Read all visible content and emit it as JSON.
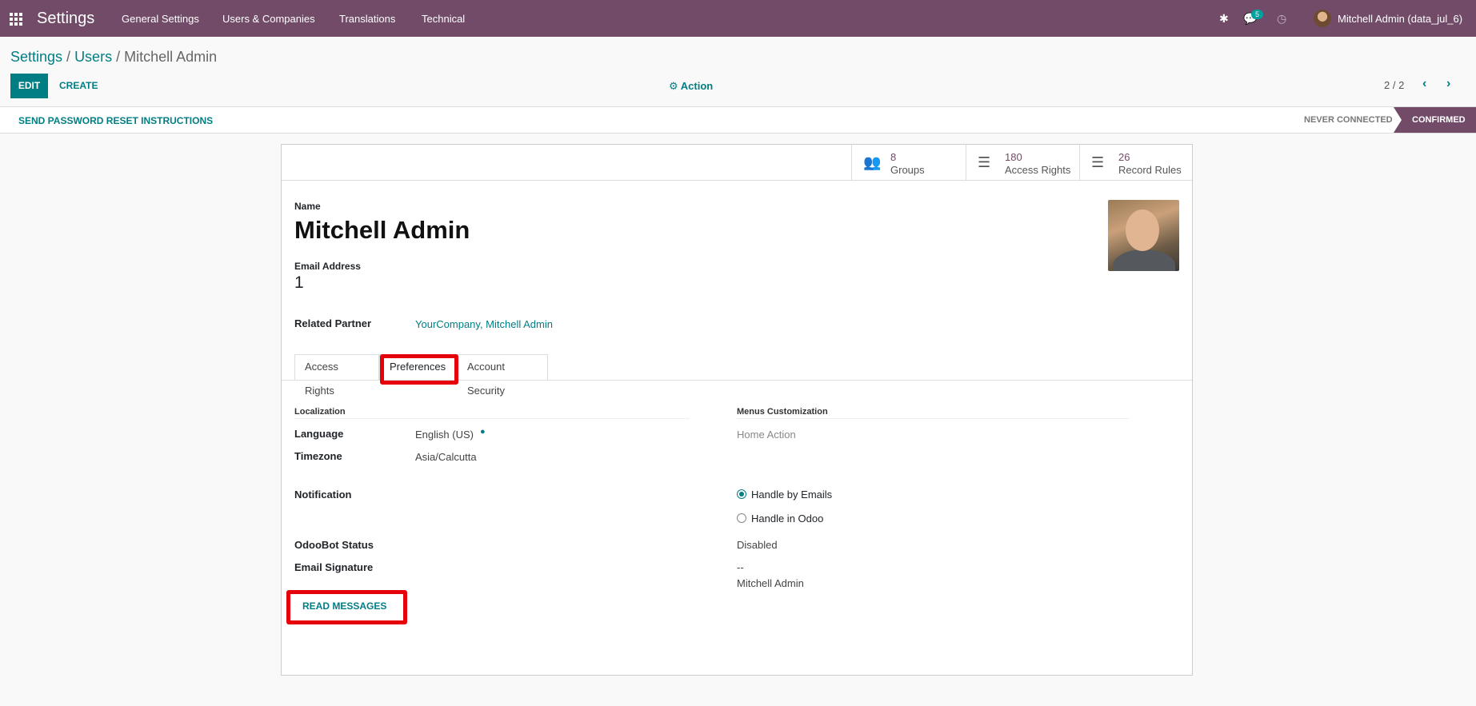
{
  "topbar": {
    "app_title": "Settings",
    "menu": [
      "General Settings",
      "Users & Companies",
      "Translations",
      "Technical"
    ],
    "icons": {
      "bug": "bug-icon",
      "chat": "chat-icon",
      "clock": "activity-clock-icon"
    },
    "chat_badge": "5",
    "user_name": "Mitchell Admin (data_jul_6)"
  },
  "breadcrumb": {
    "root": "Settings",
    "sep1": " / ",
    "mid": "Users",
    "sep2": " / ",
    "current": "Mitchell Admin"
  },
  "control": {
    "edit": "EDIT",
    "create": "CREATE",
    "action": "⚙ Action",
    "pager": "2 / 2",
    "prev": "‹",
    "next": "›"
  },
  "statusbar": {
    "reset_button": "SEND PASSWORD RESET INSTRUCTIONS",
    "stages": [
      "NEVER CONNECTED",
      "CONFIRMED"
    ],
    "active_stage": "CONFIRMED"
  },
  "smart_buttons": [
    {
      "value": "8",
      "label": "Groups",
      "icon": "users-icon"
    },
    {
      "value": "180",
      "label": "Access Rights",
      "icon": "list-icon"
    },
    {
      "value": "26",
      "label": "Record Rules",
      "icon": "list-icon"
    }
  ],
  "form": {
    "name_label": "Name",
    "name": "Mitchell Admin",
    "email_label": "Email Address",
    "email": "1",
    "partner_label": "Related Partner",
    "partner": "YourCompany, Mitchell Admin"
  },
  "tabs": [
    "Access Rights",
    "Preferences",
    "Account Security"
  ],
  "active_tab": "Preferences",
  "preferences": {
    "localization_title": "Localization",
    "language_label": "Language",
    "language": "English (US)",
    "timezone_label": "Timezone",
    "timezone": "Asia/Calcutta",
    "menus_title": "Menus Customization",
    "home_action_label": "Home Action",
    "notification_label": "Notification",
    "notification_options": [
      "Handle by Emails",
      "Handle in Odoo"
    ],
    "notification_selected": "Handle by Emails",
    "odoobot_label": "OdooBot Status",
    "odoobot": "Disabled",
    "signature_label": "Email Signature",
    "signature_line1": "--",
    "signature_line2": "Mitchell Admin",
    "read_messages": "READ MESSAGES"
  }
}
